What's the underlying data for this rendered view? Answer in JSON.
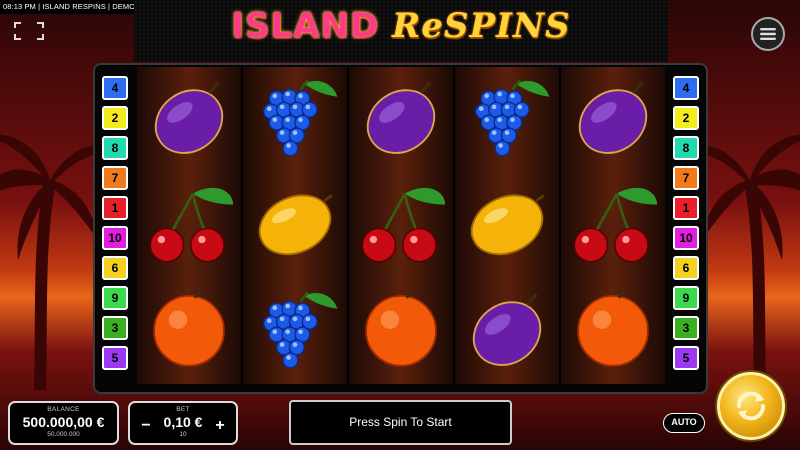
{
  "status": {
    "time": "08:13 PM",
    "game": "ISLAND RESPINS",
    "mode": "DEMO",
    "separator": " | "
  },
  "title": {
    "part1": "ISLAND ",
    "part2": "ReSPINS"
  },
  "paylines": {
    "left": [
      {
        "label": "4",
        "color": "#2f6df0"
      },
      {
        "label": "2",
        "color": "#f2ec1e"
      },
      {
        "label": "8",
        "color": "#22d9b0"
      },
      {
        "label": "7",
        "color": "#f07a1c"
      },
      {
        "label": "1",
        "color": "#e8202a"
      },
      {
        "label": "10",
        "color": "#e21ee0"
      },
      {
        "label": "6",
        "color": "#f2d21e"
      },
      {
        "label": "9",
        "color": "#3ad94e"
      },
      {
        "label": "3",
        "color": "#3ab020"
      },
      {
        "label": "5",
        "color": "#9a3af0"
      }
    ],
    "right": [
      {
        "label": "4",
        "color": "#2f6df0"
      },
      {
        "label": "2",
        "color": "#f2ec1e"
      },
      {
        "label": "8",
        "color": "#22d9b0"
      },
      {
        "label": "7",
        "color": "#f07a1c"
      },
      {
        "label": "1",
        "color": "#e8202a"
      },
      {
        "label": "10",
        "color": "#e21ee0"
      },
      {
        "label": "6",
        "color": "#f2d21e"
      },
      {
        "label": "9",
        "color": "#3ad94e"
      },
      {
        "label": "3",
        "color": "#3ab020"
      },
      {
        "label": "5",
        "color": "#9a3af0"
      }
    ]
  },
  "reels": [
    [
      "plum",
      "grapes",
      "plum",
      "grapes",
      "plum"
    ],
    [
      "cherries",
      "lemon",
      "cherries",
      "lemon",
      "cherries"
    ],
    [
      "orange",
      "grapes",
      "orange",
      "plum",
      "orange"
    ]
  ],
  "balance": {
    "label": "BALANCE",
    "value": "500.000,00 €",
    "sub": "50.000.000"
  },
  "bet": {
    "label": "BET",
    "value": "0,10 €",
    "sub": "10",
    "minus": "−",
    "plus": "+"
  },
  "message": "Press Spin To Start",
  "auto_label": "AUTO",
  "icons": {
    "menu": "menu-icon",
    "fullscreen": "fullscreen-icon",
    "spin": "spin-icon"
  }
}
